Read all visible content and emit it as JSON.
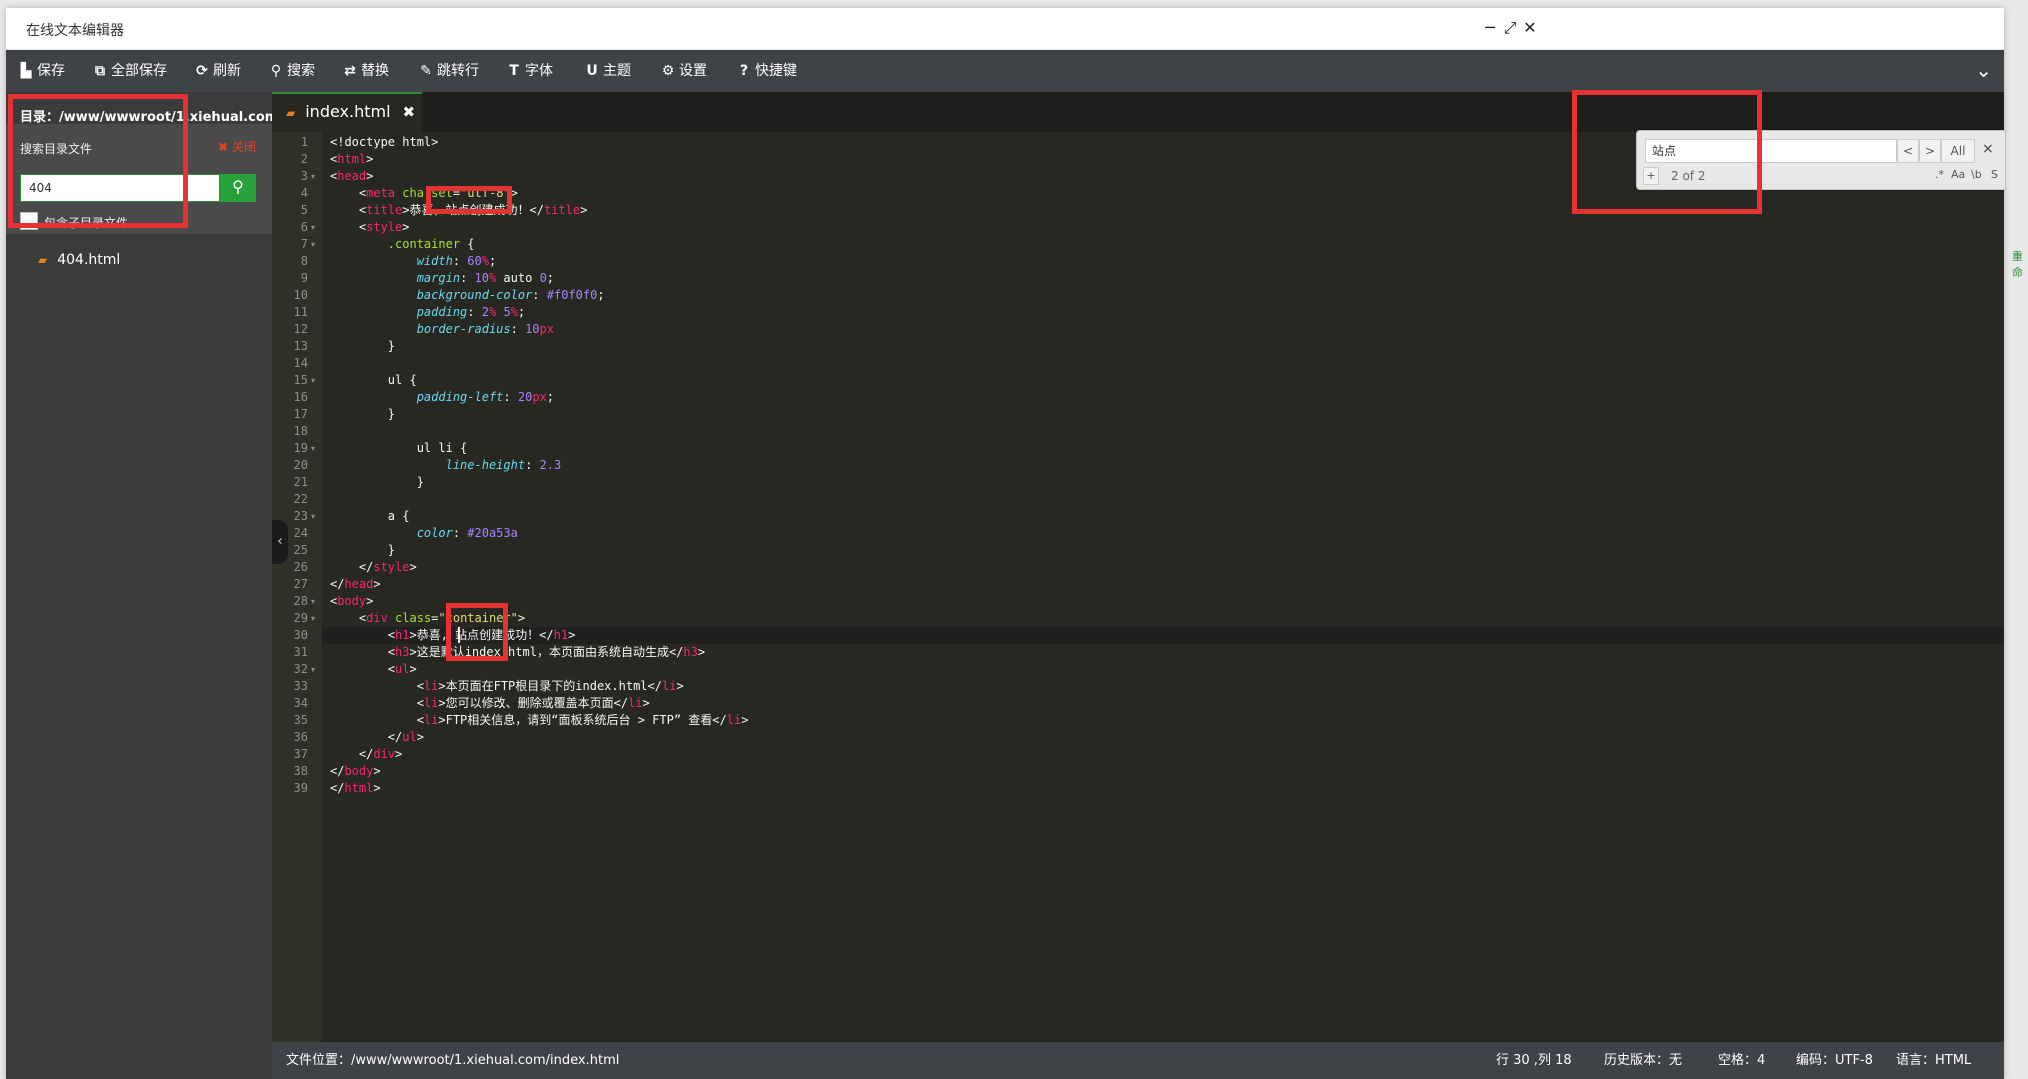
{
  "window": {
    "title": "在线文本编辑器",
    "controls": [
      "─",
      "⤢",
      "✕"
    ]
  },
  "toolbar": {
    "buttons": [
      {
        "icon": "save-icon",
        "glyph": "▙",
        "label": "保存"
      },
      {
        "icon": "save-all-icon",
        "glyph": "⧉",
        "label": "全部保存"
      },
      {
        "icon": "refresh-icon",
        "glyph": "⟳",
        "label": "刷新"
      },
      {
        "icon": "search-icon",
        "glyph": "⚲",
        "label": "搜索"
      },
      {
        "icon": "replace-icon",
        "glyph": "⇄",
        "label": "替换"
      },
      {
        "icon": "goto-line-icon",
        "glyph": "✎",
        "label": "跳转行"
      },
      {
        "icon": "font-icon",
        "glyph": "T",
        "label": "字体"
      },
      {
        "icon": "theme-icon",
        "glyph": "U",
        "label": "主题"
      },
      {
        "icon": "settings-icon",
        "glyph": "⚙",
        "label": "设置"
      },
      {
        "icon": "shortcut-icon",
        "glyph": "?",
        "label": "快捷键"
      }
    ],
    "collapse_glyph": "⌄"
  },
  "sidebar": {
    "directory": "目录：/www/wwwroot/1.xiehual.com",
    "search_title": "搜索目录文件",
    "close_label": "✖ 关闭",
    "search_value": "404",
    "search_button_glyph": "⚲",
    "include_subdir_label": "包含子目录文件",
    "results": [
      {
        "name": "404.html",
        "icon": "html5-file-icon"
      }
    ]
  },
  "editor": {
    "tab": {
      "name": "index.html",
      "close": "✖",
      "icon": "html5-file-icon"
    },
    "active_line": 30,
    "code_lines": [
      [
        [
          "<!doctype html>",
          ""
        ]
      ],
      [
        [
          "<",
          ""
        ],
        [
          "html",
          "t-tag"
        ],
        [
          ">",
          ""
        ]
      ],
      [
        [
          "<",
          ""
        ],
        [
          "head",
          "t-tag"
        ],
        [
          ">",
          ""
        ]
      ],
      [
        [
          "    <",
          ""
        ],
        [
          "meta",
          "t-tag"
        ],
        [
          " ",
          ""
        ],
        [
          "charset",
          "t-attr"
        ],
        [
          "=",
          ""
        ],
        [
          "\"utf-8\"",
          "t-str"
        ],
        [
          ">",
          ""
        ]
      ],
      [
        [
          "    <",
          ""
        ],
        [
          "title",
          "t-tag"
        ],
        [
          ">恭喜，站点创建成功！</",
          ""
        ],
        [
          "title",
          "t-tag"
        ],
        [
          ">",
          ""
        ]
      ],
      [
        [
          "    <",
          ""
        ],
        [
          "style",
          "t-tag"
        ],
        [
          ">",
          ""
        ]
      ],
      [
        [
          "        ",
          ""
        ],
        [
          ".container",
          "t-sel"
        ],
        [
          " {",
          ""
        ]
      ],
      [
        [
          "            ",
          ""
        ],
        [
          "width",
          "t-prop"
        ],
        [
          ": ",
          ""
        ],
        [
          "60",
          "t-num"
        ],
        [
          "%",
          "t-unit"
        ],
        [
          ";",
          ""
        ]
      ],
      [
        [
          "            ",
          ""
        ],
        [
          "margin",
          "t-prop"
        ],
        [
          ": ",
          ""
        ],
        [
          "10",
          "t-num"
        ],
        [
          "%",
          "t-unit"
        ],
        [
          " auto ",
          ""
        ],
        [
          "0",
          "t-num"
        ],
        [
          ";",
          ""
        ]
      ],
      [
        [
          "            ",
          ""
        ],
        [
          "background-color",
          "t-prop"
        ],
        [
          ": ",
          ""
        ],
        [
          "#f0f0f0",
          "t-num"
        ],
        [
          ";",
          ""
        ]
      ],
      [
        [
          "            ",
          ""
        ],
        [
          "padding",
          "t-prop"
        ],
        [
          ": ",
          ""
        ],
        [
          "2",
          "t-num"
        ],
        [
          "%",
          "t-unit"
        ],
        [
          " ",
          ""
        ],
        [
          "5",
          "t-num"
        ],
        [
          "%",
          "t-unit"
        ],
        [
          ";",
          ""
        ]
      ],
      [
        [
          "            ",
          ""
        ],
        [
          "border-radius",
          "t-prop"
        ],
        [
          ": ",
          ""
        ],
        [
          "10",
          "t-num"
        ],
        [
          "px",
          "t-unit"
        ]
      ],
      [
        [
          "        }",
          ""
        ]
      ],
      [
        [
          "",
          ""
        ]
      ],
      [
        [
          "        ul {",
          ""
        ]
      ],
      [
        [
          "            ",
          ""
        ],
        [
          "padding-left",
          "t-prop"
        ],
        [
          ": ",
          ""
        ],
        [
          "20",
          "t-num"
        ],
        [
          "px",
          "t-unit"
        ],
        [
          ";",
          ""
        ]
      ],
      [
        [
          "        }",
          ""
        ]
      ],
      [
        [
          "",
          ""
        ]
      ],
      [
        [
          "            ul li {",
          ""
        ]
      ],
      [
        [
          "                ",
          ""
        ],
        [
          "line-height",
          "t-prop"
        ],
        [
          ": ",
          ""
        ],
        [
          "2.3",
          "t-num"
        ]
      ],
      [
        [
          "            }",
          ""
        ]
      ],
      [
        [
          "",
          ""
        ]
      ],
      [
        [
          "        a {",
          ""
        ]
      ],
      [
        [
          "            ",
          ""
        ],
        [
          "color",
          "t-prop"
        ],
        [
          ": ",
          ""
        ],
        [
          "#20a53a",
          "t-num"
        ]
      ],
      [
        [
          "        }",
          ""
        ]
      ],
      [
        [
          "    </",
          ""
        ],
        [
          "style",
          "t-tag"
        ],
        [
          ">",
          ""
        ]
      ],
      [
        [
          "</",
          ""
        ],
        [
          "head",
          "t-tag"
        ],
        [
          ">",
          ""
        ]
      ],
      [
        [
          "<",
          ""
        ],
        [
          "body",
          "t-tag"
        ],
        [
          ">",
          ""
        ]
      ],
      [
        [
          "    <",
          ""
        ],
        [
          "div",
          "t-tag"
        ],
        [
          " ",
          ""
        ],
        [
          "class",
          "t-attr"
        ],
        [
          "=",
          ""
        ],
        [
          "\"container\"",
          "t-str"
        ],
        [
          ">",
          ""
        ]
      ],
      [
        [
          "        <",
          ""
        ],
        [
          "h1",
          "t-tag"
        ],
        [
          ">恭喜, 站点创建成功！</",
          ""
        ],
        [
          "h1",
          "t-tag"
        ],
        [
          ">",
          ""
        ]
      ],
      [
        [
          "        <",
          ""
        ],
        [
          "h3",
          "t-tag"
        ],
        [
          ">这是默认index.html，本页面由系统自动生成</",
          ""
        ],
        [
          "h3",
          "t-tag"
        ],
        [
          ">",
          ""
        ]
      ],
      [
        [
          "        <",
          ""
        ],
        [
          "ul",
          "t-tag"
        ],
        [
          ">",
          ""
        ]
      ],
      [
        [
          "            <",
          ""
        ],
        [
          "li",
          "t-tag"
        ],
        [
          ">本页面在FTP根目录下的index.html</",
          ""
        ],
        [
          "li",
          "t-tag"
        ],
        [
          ">",
          ""
        ]
      ],
      [
        [
          "            <",
          ""
        ],
        [
          "li",
          "t-tag"
        ],
        [
          ">您可以修改、删除或覆盖本页面</",
          ""
        ],
        [
          "li",
          "t-tag"
        ],
        [
          ">",
          ""
        ]
      ],
      [
        [
          "            <",
          ""
        ],
        [
          "li",
          "t-tag"
        ],
        [
          ">FTP相关信息，请到“面板系统后台 > FTP” 查看</",
          ""
        ],
        [
          "li",
          "t-tag"
        ],
        [
          ">",
          ""
        ]
      ],
      [
        [
          "        </",
          ""
        ],
        [
          "ul",
          "t-tag"
        ],
        [
          ">",
          ""
        ]
      ],
      [
        [
          "    </",
          ""
        ],
        [
          "div",
          "t-tag"
        ],
        [
          ">",
          ""
        ]
      ],
      [
        [
          "</",
          ""
        ],
        [
          "body",
          "t-tag"
        ],
        [
          ">",
          ""
        ]
      ],
      [
        [
          "</",
          ""
        ],
        [
          "html",
          "t-tag"
        ],
        [
          ">",
          ""
        ]
      ]
    ],
    "fold_lines": [
      3,
      6,
      7,
      15,
      19,
      23,
      28,
      29,
      32
    ]
  },
  "find": {
    "query": "站点",
    "prev": "<",
    "next": ">",
    "all": "All",
    "close": "×",
    "toggle": "+",
    "count": "2 of 2",
    "options": [
      ".*",
      "Aa",
      "\\b",
      "S"
    ]
  },
  "side_hint": "重命",
  "expand_glyph": "‹",
  "statusbar": {
    "path": "文件位置：/www/wwwroot/1.xiehual.com/index.html",
    "cursor": "行 30 ,列 18",
    "history": "历史版本：无",
    "indent": "空格：4",
    "encoding": "编码：UTF-8",
    "language": "语言：HTML"
  },
  "colors": {
    "accent": "#27a23a",
    "highlight_box": "#e53333",
    "editor_bg": "#272822"
  }
}
